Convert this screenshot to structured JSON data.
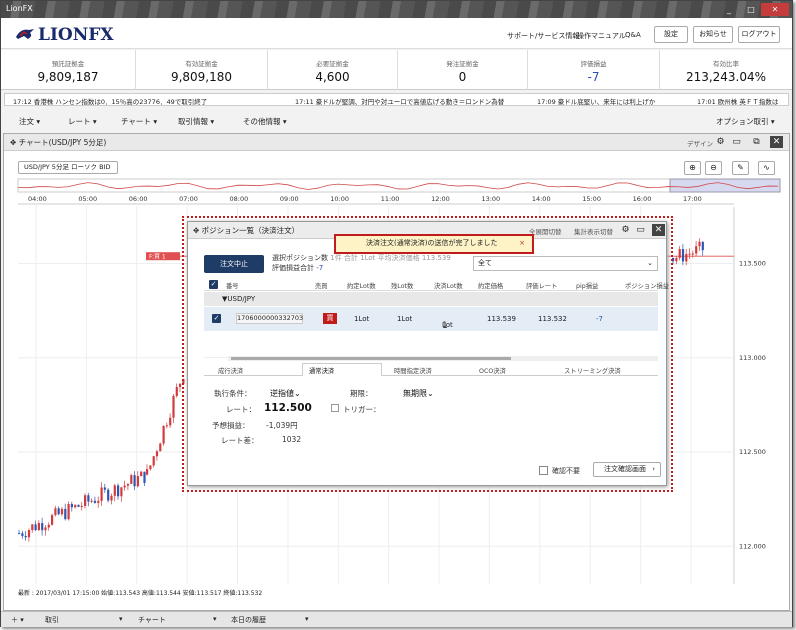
{
  "window": {
    "title": "LionFX",
    "minimize": "_",
    "maximize": "□",
    "close": "✕"
  },
  "header": {
    "logo": "LIONFX",
    "links": [
      "サポート/サービス情報",
      "操作マニュアル",
      "Q&A"
    ],
    "buttons": [
      "設定",
      "お知らせ",
      "ログアウト"
    ]
  },
  "summary": [
    {
      "label": "預託証拠金",
      "value": "9,809,187"
    },
    {
      "label": "有効証拠金",
      "value": "9,809,180"
    },
    {
      "label": "必要証拠金",
      "value": "4,600"
    },
    {
      "label": "発注証拠金",
      "value": "0"
    },
    {
      "label": "評価損益",
      "value": "-7"
    },
    {
      "label": "有効比率",
      "value": "213,243.04%"
    }
  ],
  "ticker": [
    "17:12 香港株 ハンセン指数は0．15％高の23776．49で取引終了",
    "17:11 豪ドルが堅調、対円や対ユーロで高値広げる動き＝ロンドン為替",
    "17:09 豪ドル底堅い、来年には利上げか",
    "17:01 欧州株 英ＦＴ指数は"
  ],
  "menu": {
    "items": [
      "注文",
      "レート",
      "チャート",
      "取引情報",
      "その他情報"
    ],
    "right": "オプション取引"
  },
  "chart": {
    "title": "チャート(USD/JPY 5分足)",
    "design": "デザイン",
    "symbol": "USD/JPY 5分足 ローソク BID",
    "times": [
      "04:00",
      "05:00",
      "06:00",
      "07:00",
      "08:00",
      "09:00",
      "10:00",
      "11:00",
      "12:00",
      "13:00",
      "14:00",
      "15:00",
      "16:00",
      "17:00"
    ],
    "prices": [
      "113.500",
      "113.000",
      "112.500",
      "112.000"
    ],
    "marker": "F:買 1",
    "info": "最新 : 2017/03/01 17:15:00 始値:113.543 高値:113.544 安値:113.517 終値:113.532"
  },
  "dialog": {
    "title": "ポジション一覧（決済注文）",
    "link1": "全展開切替",
    "link2": "集計表示切替",
    "toast": "決済注文(通常決済)の送信が完了しました",
    "toast_close": "×",
    "cancel": "注文中止",
    "selected_label": "選択ポジション数",
    "lot_summary": "1件 合計 1Lot 平均決済価格 113.539",
    "pl_label": "評価損益合計",
    "pl_value": "-7",
    "filter": "全て",
    "columns": [
      "番号",
      "売買",
      "約定Lot数",
      "残Lot数",
      "決済Lot数",
      "約定価格",
      "評価レート",
      "pip損益",
      "ポジション損益"
    ],
    "group": "▼USD/JPY",
    "row": {
      "id": "1706000000332703",
      "side": "買",
      "lot": "1Lot",
      "remain": "1Lot",
      "settle": "1",
      "settle_unit": "Lot",
      "price": "113.539",
      "rate": "113.532",
      "pip": "-7"
    },
    "tabs": [
      "成行決済",
      "通常決済",
      "時間指定決済",
      "OCO決済",
      "ストリーミング決済"
    ],
    "form": {
      "cond_label": "執行条件：",
      "cond_value": "逆指値",
      "rate_label": "レート：",
      "rate_value": "112.500",
      "pl_label": "予想損益：",
      "pl_value": "-1,039円",
      "diff_label": "レート差：",
      "diff_value": "1032",
      "period_label": "期限：",
      "period_value": "無期限",
      "trigger_label": "トリガー："
    },
    "no_confirm": "確認不要",
    "confirm_btn": "注文確認画面"
  },
  "bottom": [
    "取引",
    "チャート",
    "本日の履歴"
  ],
  "chart_data": {
    "type": "candlestick",
    "x": [
      "04:00",
      "05:00",
      "06:00",
      "07:00",
      "08:00",
      "09:00",
      "10:00",
      "11:00",
      "12:00",
      "13:00",
      "14:00",
      "15:00",
      "16:00",
      "17:00"
    ],
    "ylim": [
      111.8,
      113.8
    ],
    "series": [
      {
        "name": "USD/JPY",
        "values": [
          112.07,
          112.1,
          112.2,
          112.3,
          112.38,
          113.05,
          112.95,
          113.2,
          113.35,
          113.45,
          113.48,
          113.5,
          113.53,
          113.58
        ]
      }
    ]
  }
}
